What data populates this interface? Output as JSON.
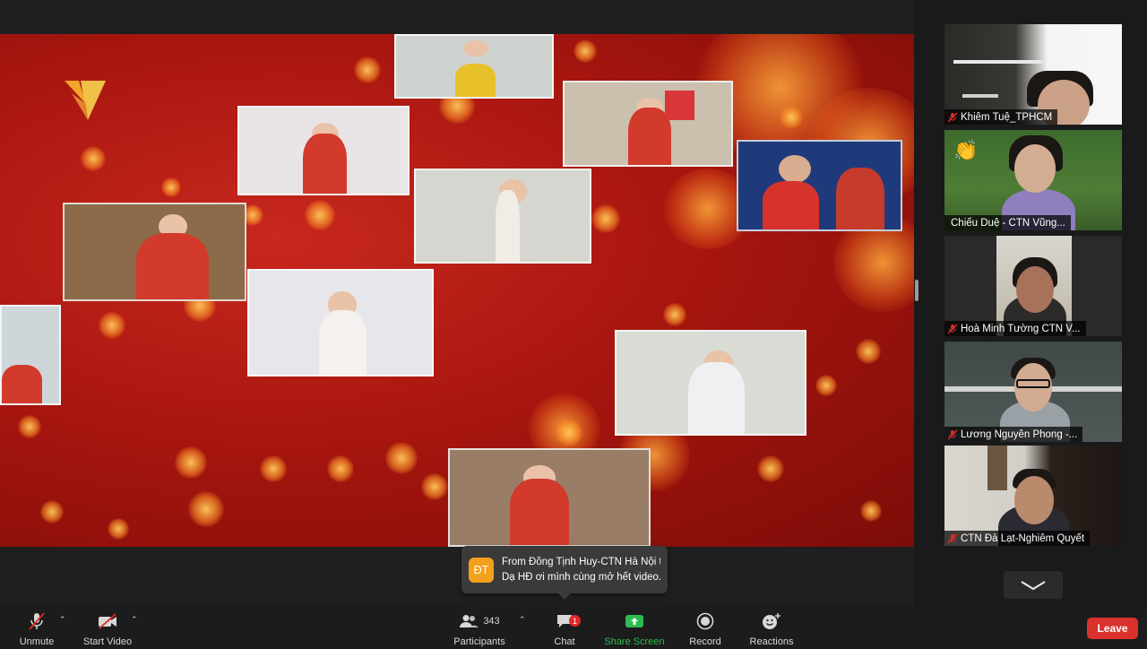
{
  "app": {
    "name": "Zoom Meeting"
  },
  "participants_panel": {
    "tiles": [
      {
        "name": "Khiêm Tuệ_TPHCM",
        "muted": true
      },
      {
        "name": "Chiếu Duệ - CTN Vũng...",
        "muted": false,
        "reaction": "clapping-hands"
      },
      {
        "name": "Hoà Minh Tường CTN V...",
        "muted": true
      },
      {
        "name": "Lương Nguyên Phong -...",
        "muted": true
      },
      {
        "name": "CTN Đà Lạt-Nghiêm Quyết",
        "muted": true
      }
    ]
  },
  "chat_notification": {
    "avatar_initials": "ĐT",
    "title": "From Đồng Tịnh Huy-CTN Hà Nội t...",
    "message": "Dạ HĐ ơi mình cùng mở hết video..."
  },
  "toolbar": {
    "unmute_label": "Unmute",
    "start_video_label": "Start Video",
    "participants_label": "Participants",
    "participants_count": "343",
    "chat_label": "Chat",
    "chat_badge": "1",
    "share_screen_label": "Share Screen",
    "record_label": "Record",
    "reactions_label": "Reactions",
    "leave_label": "Leave"
  },
  "colors": {
    "share_accent": "#2dbb4f",
    "leave": "#d9312b",
    "mute_red": "#e02828",
    "badge": "#e02828"
  }
}
